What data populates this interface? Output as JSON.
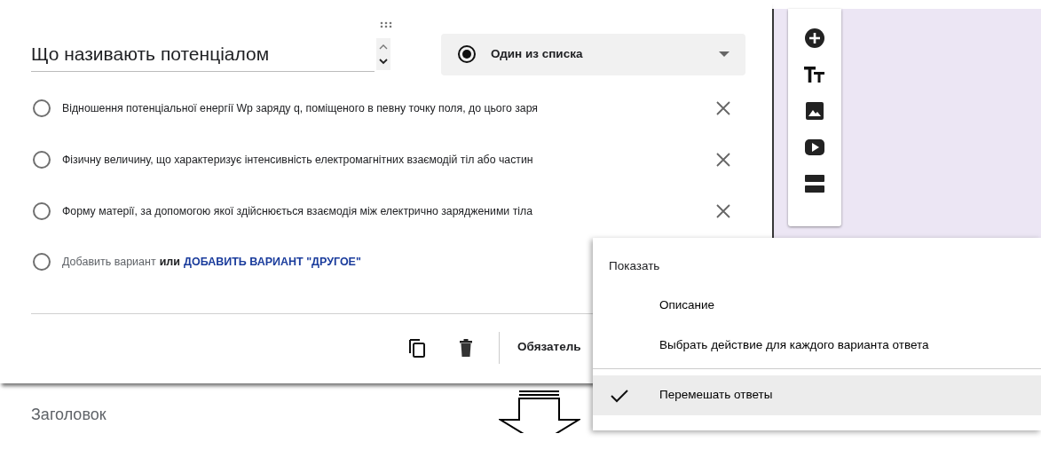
{
  "question": {
    "title": "Що називають потенціалом",
    "type": {
      "label": "Один из списка"
    }
  },
  "options": [
    {
      "text": "Відношення потенціальної енергії Wp заряду q, поміщеного в певну точку поля, до цього заря",
      "selected": false
    },
    {
      "text": "Фізичну величину, що характеризує інтенсивність електромагнітних взаємодій тіл або частин",
      "selected": false
    },
    {
      "text": "Форму матерії, за допомогою якої здійснюється взаємодія між електрично зарядженими тіла",
      "selected": false
    }
  ],
  "add_option": {
    "selected": false,
    "add": "Добавить вариант",
    "or": "или",
    "add_other": "ДОБАВИТЬ ВАРИАНТ \"ДРУГОЕ\""
  },
  "footer": {
    "required_label": "Обязатель"
  },
  "next_section": {
    "title": "Заголовок"
  },
  "menu": {
    "header": "Показать",
    "groups": [
      [
        {
          "label": "Описание",
          "checked": false
        },
        {
          "label": "Выбрать действие для каждого варианта ответа",
          "checked": false
        }
      ],
      [
        {
          "label": "Перемешать ответы",
          "checked": true
        }
      ]
    ]
  }
}
